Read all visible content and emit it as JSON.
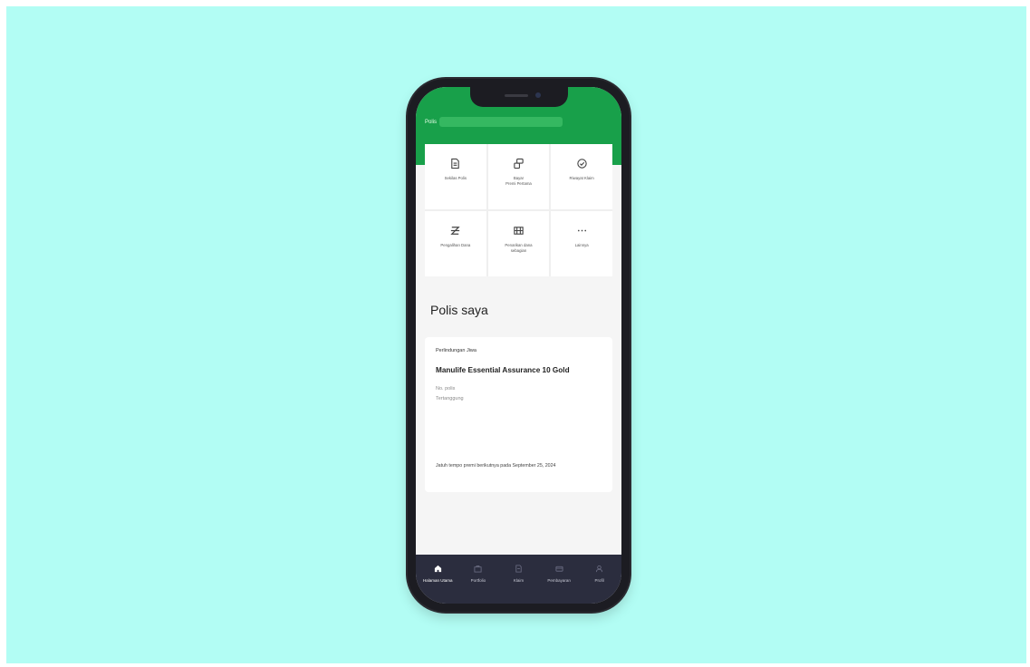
{
  "header": {
    "title": "Polis"
  },
  "menu": [
    {
      "label": "Sekilas Polis",
      "icon": "document-icon"
    },
    {
      "label": "Bayar\nPremi Pertama",
      "icon": "payment-icon"
    },
    {
      "label": "Riwayat Klaim",
      "icon": "clock-check-icon"
    },
    {
      "label": "Pengalihan Dana",
      "icon": "transfer-icon"
    },
    {
      "label": "Penarikan dana\nsebagian",
      "icon": "withdraw-icon"
    },
    {
      "label": "Lainnya",
      "icon": "more-icon"
    }
  ],
  "section_title": "Polis saya",
  "policy": {
    "type": "Perlindungan Jiwa",
    "name": "Manulife Essential Assurance 10 Gold",
    "number_label": "No. polis",
    "status": "Tertanggung",
    "note": "Jatuh tempo premi berikutnya pada September 25, 2024"
  },
  "nav": [
    {
      "label": "Halaman Utama",
      "icon": "home-icon",
      "active": true
    },
    {
      "label": "Portfolio",
      "icon": "portfolio-icon",
      "active": false
    },
    {
      "label": "Klaim",
      "icon": "claim-icon",
      "active": false
    },
    {
      "label": "Pembayaran",
      "icon": "payment-nav-icon",
      "active": false
    },
    {
      "label": "Profil",
      "icon": "profile-icon",
      "active": false
    }
  ],
  "colors": {
    "background": "#b2fdf4",
    "header_green": "#18a04a",
    "nav_dark": "#2b2d3e"
  }
}
